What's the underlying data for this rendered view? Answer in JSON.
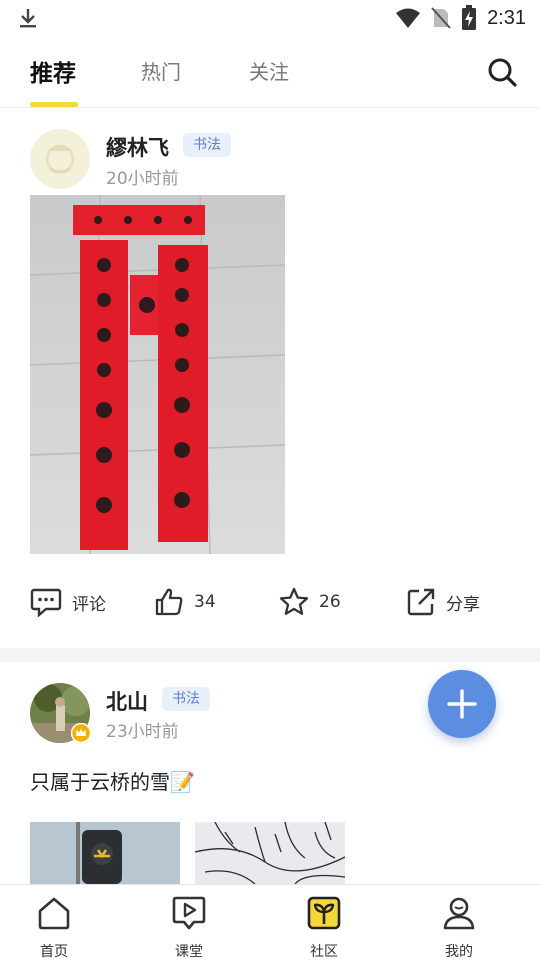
{
  "status_bar": {
    "time": "2:31"
  },
  "tabs": [
    {
      "label": "推荐",
      "active": true
    },
    {
      "label": "热门",
      "active": false
    },
    {
      "label": "关注",
      "active": false
    }
  ],
  "posts": [
    {
      "username": "繆林飞",
      "tag": "书法",
      "time": "20小时前",
      "actions": {
        "comment_label": "评论",
        "like_count": "34",
        "favorite_count": "26",
        "share_label": "分享"
      }
    },
    {
      "username": "北山",
      "tag": "书法",
      "time": "23小时前",
      "text": "只属于云桥的雪📝"
    }
  ],
  "bottom_nav": [
    {
      "label": "首页",
      "icon": "home-icon"
    },
    {
      "label": "课堂",
      "icon": "classroom-icon"
    },
    {
      "label": "社区",
      "icon": "community-icon",
      "active": true
    },
    {
      "label": "我的",
      "icon": "profile-icon"
    }
  ],
  "colors": {
    "accent_yellow": "#f5d73a",
    "fab_blue": "#5b8de0",
    "tag_bg": "#e9effb",
    "tag_text": "#5b7fcf"
  }
}
